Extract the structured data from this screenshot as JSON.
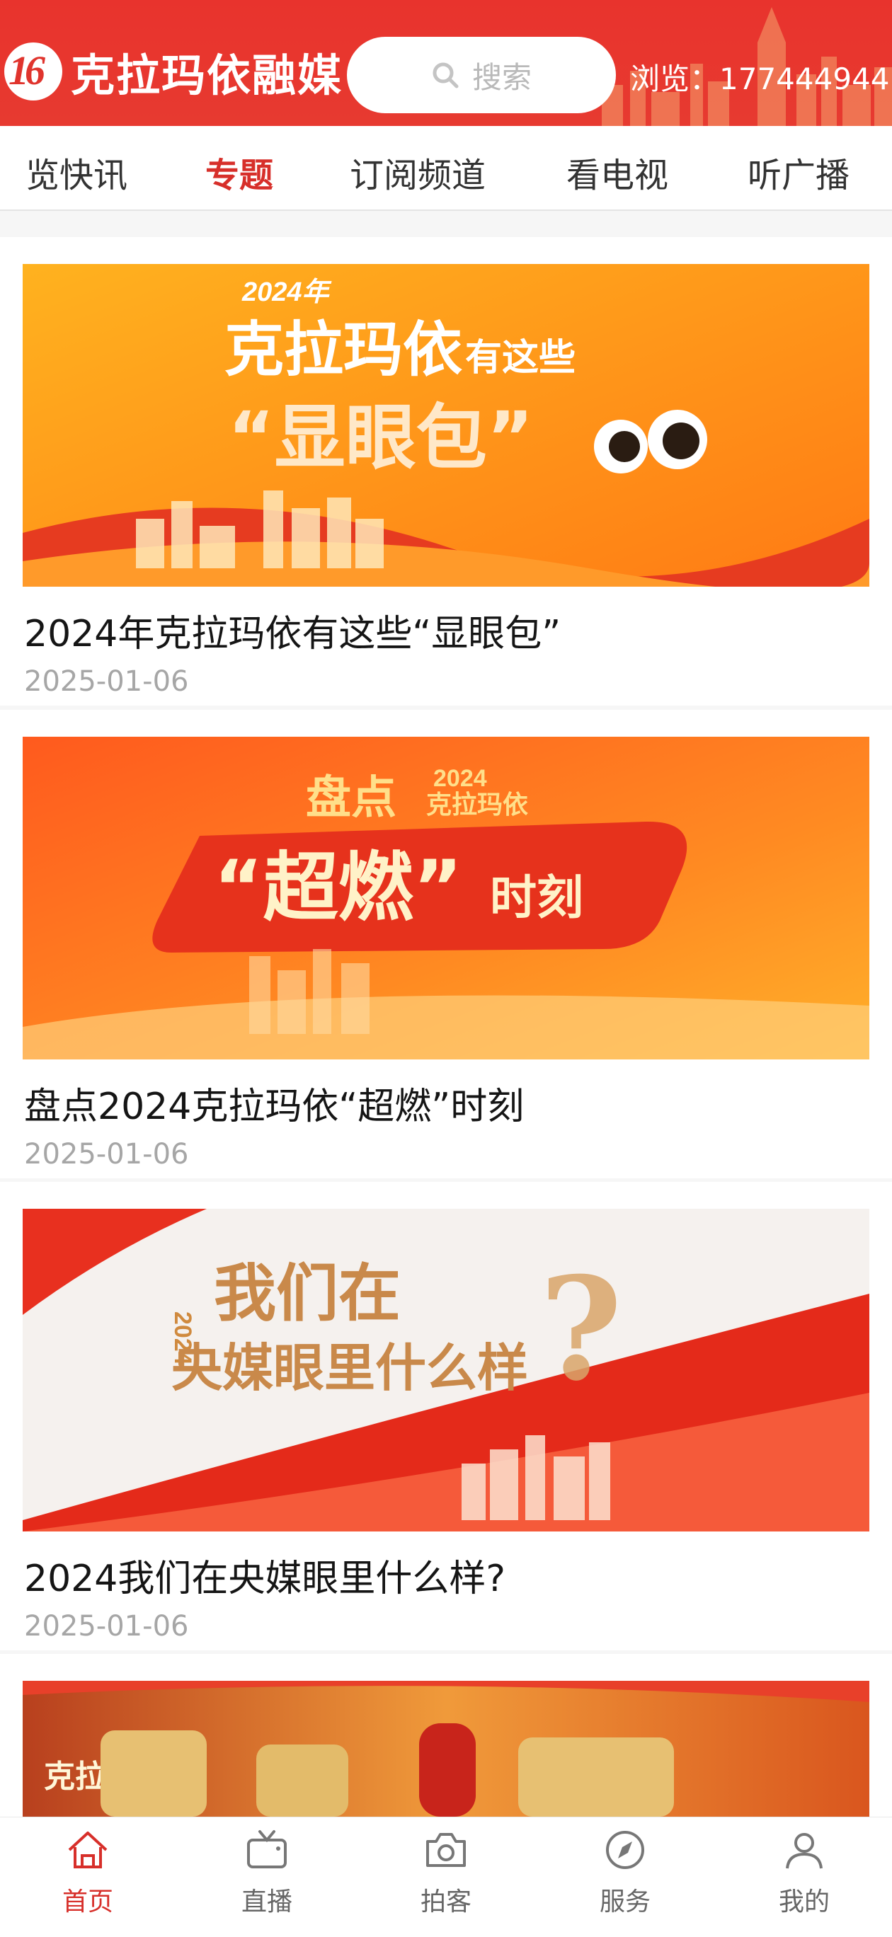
{
  "header": {
    "logo_text": "克拉玛依融媒",
    "logo_mark": "16",
    "search_placeholder": "搜索",
    "views_label": "浏览：",
    "views_count": "177444944",
    "brand_color": "#e8332d"
  },
  "tabs": [
    {
      "label": "览快讯"
    },
    {
      "label": "专题"
    },
    {
      "label": "订阅频道"
    },
    {
      "label": "看电视"
    },
    {
      "label": "听广播"
    }
  ],
  "active_tab": "专题",
  "articles": [
    {
      "title": "2024年克拉玛依有这些“显眼包”",
      "date": "2025-01-06",
      "banner": {
        "line1": "2024年",
        "line2": "克拉玛依",
        "line2b": "有这些",
        "line3": "“显眼包”"
      }
    },
    {
      "title": "盘点2024克拉玛依“超燃”时刻",
      "date": "2025-01-06",
      "banner": {
        "line1": "盘点",
        "line1b": "2024",
        "line1c": "克拉玛依",
        "line2": "“超燃”",
        "line2b": "时刻"
      }
    },
    {
      "title": "2024我们在央媒眼里什么样?",
      "date": "2025-01-06",
      "banner": {
        "year": "2024",
        "line1": "我们在",
        "line2": "央媒眼里什么样",
        "mark": "?"
      }
    },
    {
      "banner": {
        "line1": "克拉"
      }
    }
  ],
  "bottom_nav": [
    {
      "label": "首页",
      "icon": "home-icon",
      "active": true
    },
    {
      "label": "直播",
      "icon": "tv-icon",
      "active": false
    },
    {
      "label": "拍客",
      "icon": "camera-icon",
      "active": false
    },
    {
      "label": "服务",
      "icon": "compass-icon",
      "active": false
    },
    {
      "label": "我的",
      "icon": "user-icon",
      "active": false
    }
  ],
  "colors": {
    "accent": "#d72f2a",
    "muted": "#a6a6a6"
  }
}
